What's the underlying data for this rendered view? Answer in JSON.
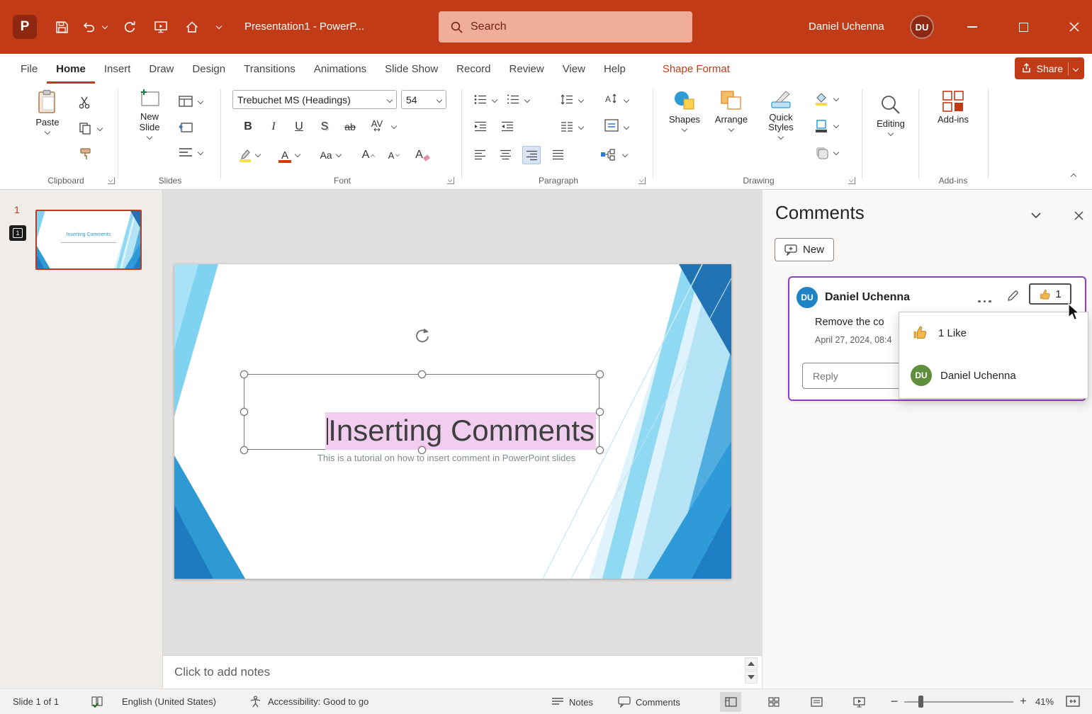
{
  "titlebar": {
    "title": "Presentation1  -  PowerP...",
    "search_placeholder": "Search",
    "user_name": "Daniel Uchenna",
    "user_initials": "DU"
  },
  "ribbon": {
    "tabs": [
      {
        "label": "File"
      },
      {
        "label": "Home"
      },
      {
        "label": "Insert"
      },
      {
        "label": "Draw"
      },
      {
        "label": "Design"
      },
      {
        "label": "Transitions"
      },
      {
        "label": "Animations"
      },
      {
        "label": "Slide Show"
      },
      {
        "label": "Record"
      },
      {
        "label": "Review"
      },
      {
        "label": "View"
      },
      {
        "label": "Help"
      },
      {
        "label": "Shape Format"
      }
    ],
    "share_label": "Share",
    "clipboard": {
      "group_label": "Clipboard",
      "paste_label": "Paste"
    },
    "slides": {
      "group_label": "Slides",
      "new_slide_label": "New Slide"
    },
    "font": {
      "group_label": "Font",
      "font_name": "Trebuchet MS (Headings)",
      "font_size": "54",
      "bold_label": "B",
      "italic_label": "I",
      "underline_label": "U",
      "shadow_label": "S",
      "strike_label": "ab",
      "spacing_label": "AV",
      "case_label": "Aa",
      "grow_label": "A",
      "shrink_label": "A",
      "clear_label": "A",
      "color_label": "A"
    },
    "paragraph": {
      "group_label": "Paragraph"
    },
    "drawing": {
      "group_label": "Drawing",
      "shapes_label": "Shapes",
      "arrange_label": "Arrange",
      "quick_styles_label": "Quick Styles"
    },
    "editing": {
      "label": "Editing"
    },
    "addins": {
      "group_label": "Add-ins",
      "button_label": "Add-ins"
    }
  },
  "thumbnail_panel": {
    "slide_number": "1",
    "comment_badge_count": "1"
  },
  "slide": {
    "title": "Inserting Comments",
    "subtitle": "This is a tutorial on how to insert comment in PowerPoint slides"
  },
  "notes": {
    "placeholder": "Click to add notes"
  },
  "comments": {
    "pane_title": "Comments",
    "new_button_label": "New",
    "card": {
      "author": "Daniel Uchenna",
      "author_initials": "DU",
      "body": "Remove the co",
      "timestamp": "April 27, 2024, 08:4",
      "like_count": "1",
      "reply_placeholder": "Reply"
    },
    "flyout": {
      "likes_label": "1 Like",
      "liker_name": "Daniel Uchenna",
      "liker_initials": "DU"
    }
  },
  "statusbar": {
    "slide_indicator": "Slide 1 of 1",
    "language": "English (United States)",
    "accessibility_status": "Accessibility: Good to go",
    "notes_label": "Notes",
    "comments_label": "Comments",
    "zoom_level": "41%"
  },
  "colors": {
    "titlebar_red": "#C13B17",
    "comment_selection_purple": "#8F3FBF",
    "text_highlight_pink": "#F1CEEF"
  }
}
